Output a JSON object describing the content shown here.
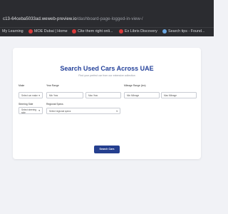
{
  "browser": {
    "url_host": "c13-64ceba5033ad.weweb-preview.io",
    "url_path": "/dashboard-page-logged-in-view-/"
  },
  "bookmarks": [
    {
      "label": "My Learning",
      "color": "#555a66"
    },
    {
      "label": "MOE Dubai | Home",
      "color": "#d93a3a"
    },
    {
      "label": "Cite them right onli...",
      "color": "#d93a3a"
    },
    {
      "label": "Ex Libris Discovery",
      "color": "#d93a3a"
    },
    {
      "label": "Search tips - Found...",
      "color": "#6aa6e0"
    }
  ],
  "main": {
    "title": "Search Used Cars Across UAE",
    "subtitle": "Find your perfect car from our extensive collection",
    "fields": {
      "make_label": "Make",
      "make_value": "Select car make",
      "year_label": "Year Range",
      "year_min": "Min Year",
      "year_max": "Max Year",
      "mileage_label": "Mileage Range (km)",
      "mileage_min": "Min Mileage",
      "mileage_max": "Max Mileage",
      "steering_label": "Steering Side",
      "steering_value": "Select steering side",
      "regional_label": "Regional Specs",
      "regional_value": "Select regional specs"
    },
    "search_button": "Search Cars"
  },
  "colors": {
    "accent": "#253f8f",
    "title": "#23409a"
  }
}
